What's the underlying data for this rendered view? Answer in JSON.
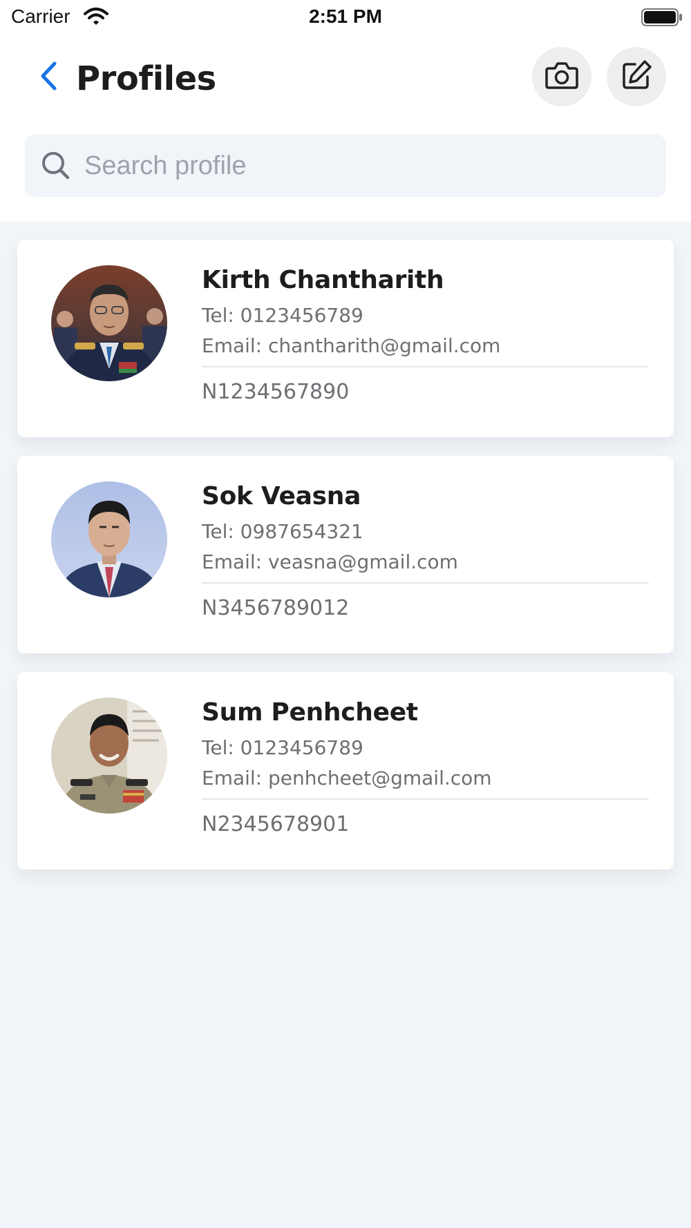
{
  "status_bar": {
    "carrier": "Carrier",
    "time": "2:51 PM"
  },
  "header": {
    "title": "Profiles",
    "back_icon": "chevron-left-icon",
    "actions": [
      "camera-icon",
      "edit-icon"
    ]
  },
  "search": {
    "placeholder": "Search profile",
    "value": ""
  },
  "profiles": [
    {
      "name": "Kirth Chantharith",
      "tel": "Tel: 0123456789",
      "email": "Email: chantharith@gmail.com",
      "id_number": "N1234567890"
    },
    {
      "name": "Sok Veasna",
      "tel": "Tel: 0987654321",
      "email": "Email: veasna@gmail.com",
      "id_number": "N3456789012"
    },
    {
      "name": "Sum Penhcheet",
      "tel": "Tel: 0123456789",
      "email": "Email: penhcheet@gmail.com",
      "id_number": "N2345678901"
    }
  ],
  "colors": {
    "accent": "#1a73e8",
    "background": "#f1f4f8",
    "card": "#ffffff",
    "text_primary": "#1d1d1f",
    "text_secondary": "#6e6e73"
  }
}
